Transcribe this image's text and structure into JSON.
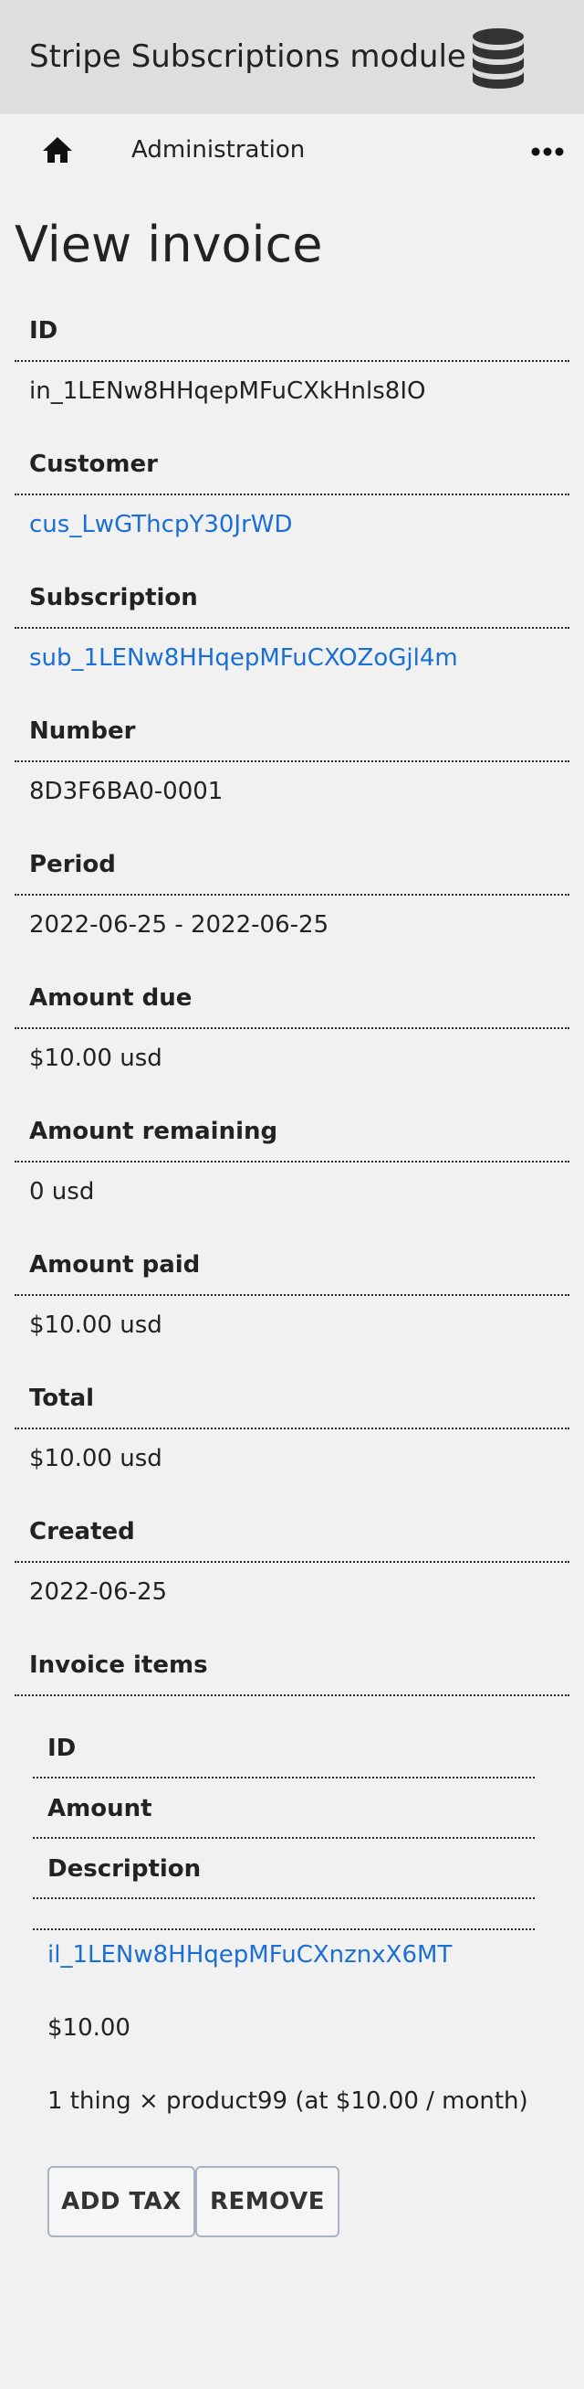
{
  "header": {
    "title": "Stripe Subscriptions module",
    "icon": "database-icon"
  },
  "nav": {
    "home_icon": "home-icon",
    "admin_label": "Administration",
    "more_icon": "more-icon"
  },
  "page": {
    "title": "View invoice"
  },
  "fields": {
    "id": {
      "label": "ID",
      "value": "in_1LENw8HHqepMFuCXkHnls8IO"
    },
    "customer": {
      "label": "Customer",
      "value": "cus_LwGThcpY30JrWD"
    },
    "subscription": {
      "label": "Subscription",
      "value": "sub_1LENw8HHqepMFuCXOZoGjl4m"
    },
    "number": {
      "label": "Number",
      "value": "8D3F6BA0-0001"
    },
    "period": {
      "label": "Period",
      "value": "2022-06-25 - 2022-06-25"
    },
    "amount_due": {
      "label": "Amount due",
      "value": "$10.00 usd"
    },
    "amount_remaining": {
      "label": "Amount remaining",
      "value": "0 usd"
    },
    "amount_paid": {
      "label": "Amount paid",
      "value": "$10.00 usd"
    },
    "total": {
      "label": "Total",
      "value": "$10.00 usd"
    },
    "created": {
      "label": "Created",
      "value": "2022-06-25"
    }
  },
  "invoice_items": {
    "label": "Invoice items",
    "headers": {
      "id": "ID",
      "amount": "Amount",
      "description": "Description"
    },
    "item": {
      "id": "il_1LENw8HHqepMFuCXnznxX6MT",
      "amount": "$10.00",
      "description": "1 thing × product99 (at $10.00 / month)"
    }
  },
  "actions": {
    "add_tax": "ADD TAX",
    "remove": "REMOVE"
  },
  "colors": {
    "header_bg": "#dedede",
    "page_bg": "#f1f1f1",
    "link": "#1a6fd6"
  }
}
